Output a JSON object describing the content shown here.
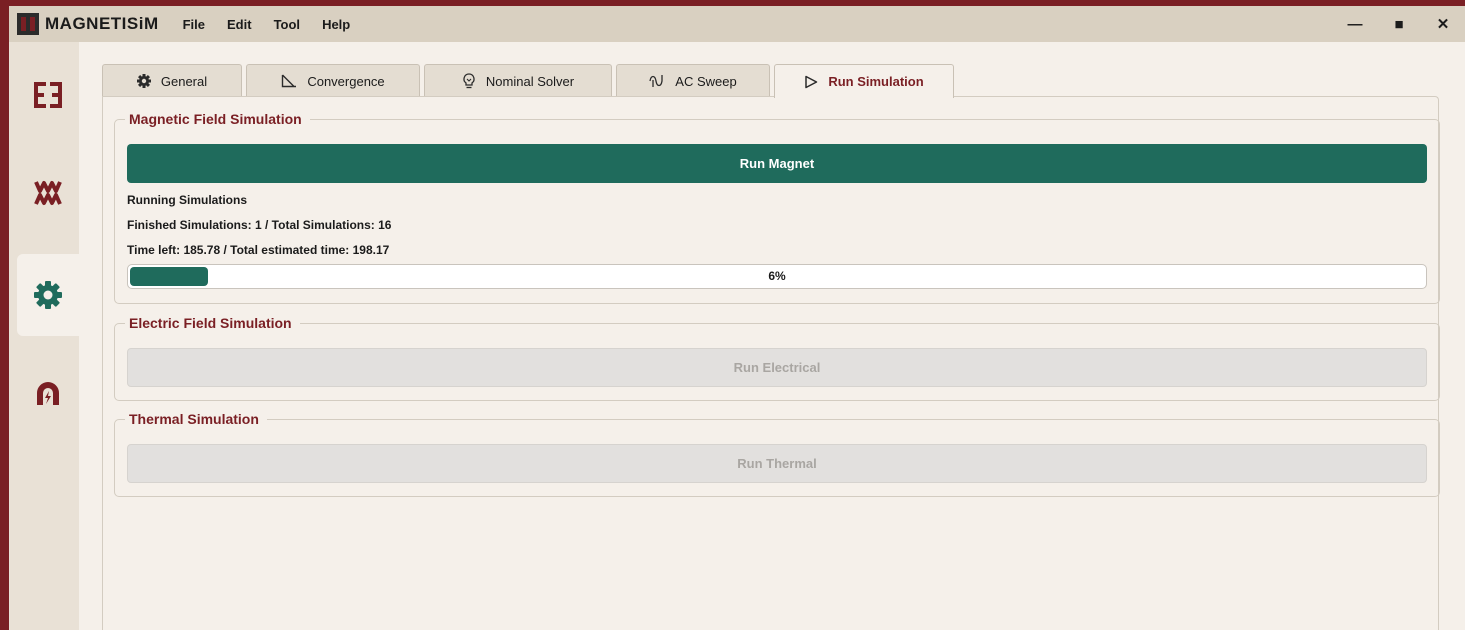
{
  "app": {
    "name": "MAGNETISiM"
  },
  "menu": [
    "File",
    "Edit",
    "Tool",
    "Help"
  ],
  "window_controls": {
    "minimize": "—",
    "maximize": "■",
    "close": "✕"
  },
  "sidebar": {
    "items": [
      {
        "icon": "core-shape-icon",
        "active": false
      },
      {
        "icon": "winding-icon",
        "active": false
      },
      {
        "icon": "gear-icon",
        "active": true
      },
      {
        "icon": "magnet-icon",
        "active": false
      }
    ]
  },
  "tabs": [
    {
      "label": "General",
      "icon": "gear-icon",
      "active": false
    },
    {
      "label": "Convergence",
      "icon": "convergence-icon",
      "active": false
    },
    {
      "label": "Nominal Solver",
      "icon": "lightbulb-icon",
      "active": false
    },
    {
      "label": "AC Sweep",
      "icon": "sine-wave-icon",
      "active": false
    },
    {
      "label": "Run Simulation",
      "icon": "play-icon",
      "active": true
    }
  ],
  "magnetic": {
    "title": "Magnetic Field Simulation",
    "button": "Run Magnet",
    "status": "Running Simulations",
    "finished": "Finished Simulations: 1 / Total Simulations: 16",
    "time": "Time left: 185.78 / Total estimated time: 198.17",
    "progress_percent": 6,
    "progress_label": "6%"
  },
  "electric": {
    "title": "Electric Field Simulation",
    "button": "Run Electrical"
  },
  "thermal": {
    "title": "Thermal Simulation",
    "button": "Run Thermal"
  },
  "colors": {
    "brand": "#7a1f24",
    "accent_green": "#1f6b5c",
    "background": "#f5f0ea",
    "titlebar": "#d9d0c1"
  }
}
